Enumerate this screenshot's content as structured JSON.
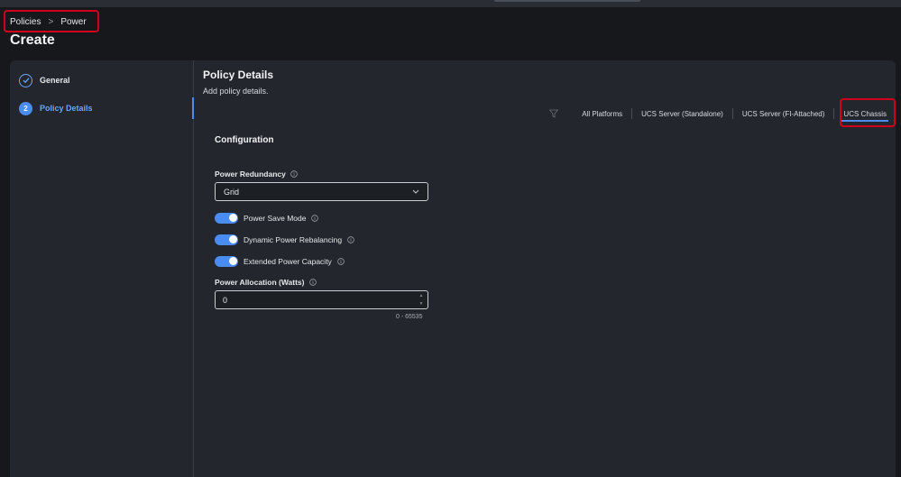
{
  "breadcrumb": {
    "items": [
      "Policies",
      "Power"
    ]
  },
  "page": {
    "title": "Create"
  },
  "wizard": {
    "steps": [
      {
        "label": "General",
        "state": "completed"
      },
      {
        "number": "2",
        "label": "Policy Details",
        "state": "active"
      }
    ]
  },
  "policy_details": {
    "title": "Policy Details",
    "subtitle": "Add policy details."
  },
  "platforms": {
    "tabs": [
      "All Platforms",
      "UCS Server (Standalone)",
      "UCS Server (FI-Attached)",
      "UCS Chassis"
    ],
    "active": "UCS Chassis"
  },
  "configuration": {
    "title": "Configuration",
    "power_redundancy": {
      "label": "Power Redundancy",
      "value": "Grid"
    },
    "toggles": [
      {
        "label": "Power Save Mode",
        "on": true
      },
      {
        "label": "Dynamic Power Rebalancing",
        "on": true
      },
      {
        "label": "Extended Power Capacity",
        "on": true
      }
    ],
    "power_allocation": {
      "label": "Power Allocation (Watts)",
      "value": "0",
      "range": "0 - 65535"
    }
  },
  "colors": {
    "accent": "#4a8df0",
    "highlight": "#d0021b",
    "panel": "#23262c",
    "background": "#16181c"
  }
}
